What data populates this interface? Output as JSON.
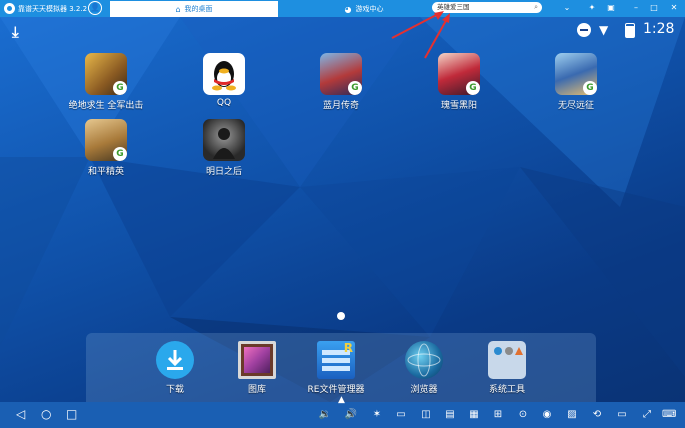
{
  "titlebar": {
    "app_title": "靠谱天天模拟器 3.2.2",
    "tabs": [
      {
        "label": "我的桌面",
        "active": true
      },
      {
        "label": "游戏中心",
        "active": false
      }
    ],
    "search": {
      "value": "英雄爱三国"
    }
  },
  "status_bar": {
    "time": "1:28"
  },
  "desktop_apps": [
    {
      "label": "绝地求生 全军出击"
    },
    {
      "label": "QQ"
    },
    {
      "label": "蓝月传奇"
    },
    {
      "label": "瑰雪黑阳"
    },
    {
      "label": "无尽远征"
    },
    {
      "label": "和平精英"
    },
    {
      "label": "明日之后"
    }
  ],
  "dock": [
    {
      "label": "下载"
    },
    {
      "label": "图库"
    },
    {
      "label": "RE文件管理器"
    },
    {
      "label": "浏览器"
    },
    {
      "label": "系统工具"
    }
  ],
  "colors": {
    "titlebar": "#1e8fe0",
    "navbar": "#1a5fb3",
    "annotation": "#e53030"
  }
}
